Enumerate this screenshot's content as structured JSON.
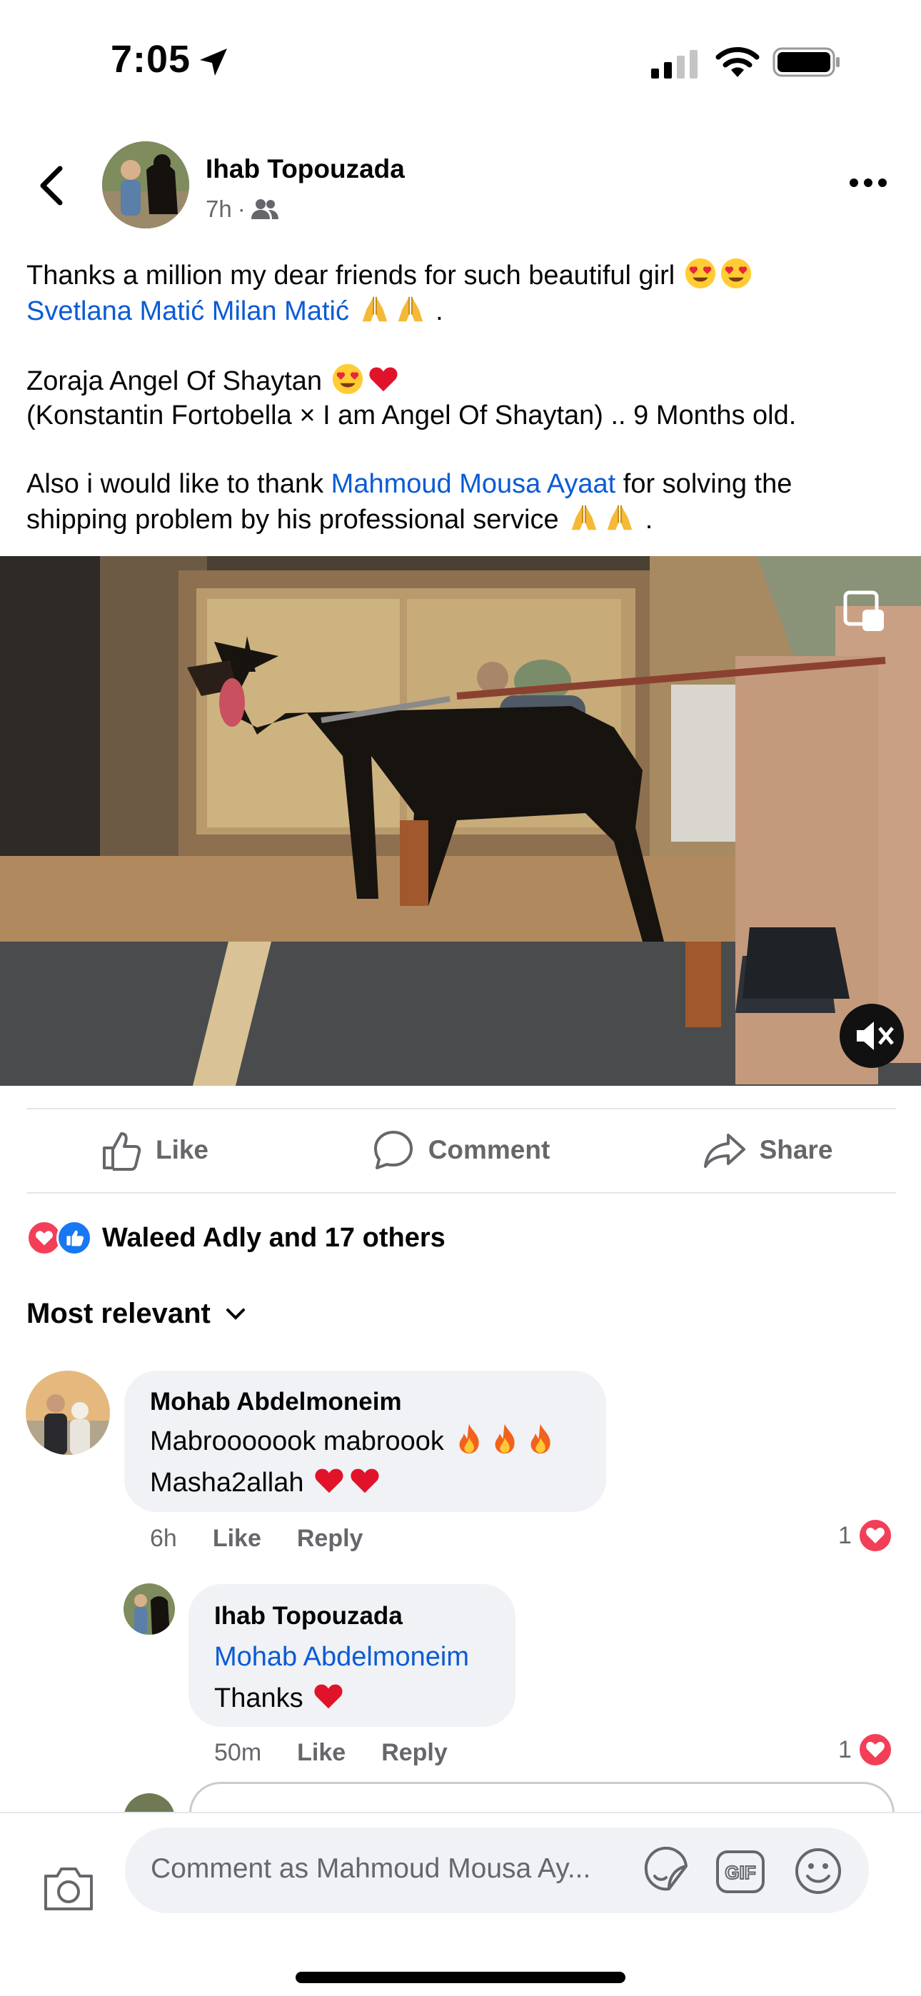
{
  "status_bar": {
    "time": "7:05"
  },
  "post": {
    "author": "Ihab Topouzada",
    "time": "7h",
    "separator": "·",
    "line1_text": "Thanks a million my dear friends for such beautiful girl",
    "tag1": "Svetlana Matić",
    "tag2": "Milan Matić",
    "line2_end": ".",
    "para2_line1": "Zoraja Angel Of Shaytan",
    "para2_line2": "(Konstantin Fortobella × I am Angel Of Shaytan) .. 9 Months old.",
    "para3_pre": "Also i would like to thank",
    "para3_link": "Mahmoud Mousa Ayaat",
    "para3_post": "for solving the",
    "para3_line2": "shipping problem by his professional service",
    "para3_end": "."
  },
  "actions": {
    "like": "Like",
    "comment": "Comment",
    "share": "Share"
  },
  "reactions": {
    "summary": "Waleed Adly and 17 others"
  },
  "sort": {
    "label": "Most relevant"
  },
  "comments": [
    {
      "author": "Mohab Abdelmoneim",
      "line1": "Mabrooooook mabroook",
      "line2": "Masha2allah",
      "time": "6h",
      "like": "Like",
      "reply": "Reply",
      "count": "1"
    },
    {
      "author": "Ihab Topouzada",
      "mention": "Mohab Abdelmoneim",
      "line1": "Thanks",
      "time": "50m",
      "like": "Like",
      "reply": "Reply",
      "count": "1"
    }
  ],
  "composer": {
    "placeholder": "Comment as Mahmoud Mousa Ay..."
  },
  "colors": {
    "link": "#0a5bd6",
    "meta_gray": "#65676b",
    "bubble": "#f0f2f5",
    "love_red": "#f33e58",
    "like_blue": "#1877f2"
  },
  "icons": [
    "back-icon",
    "more-icon",
    "friends-icon",
    "pip-icon",
    "mute-icon",
    "like-icon",
    "comment-icon",
    "share-icon",
    "camera-icon",
    "sticker-icon",
    "gif-icon",
    "smile-icon"
  ]
}
